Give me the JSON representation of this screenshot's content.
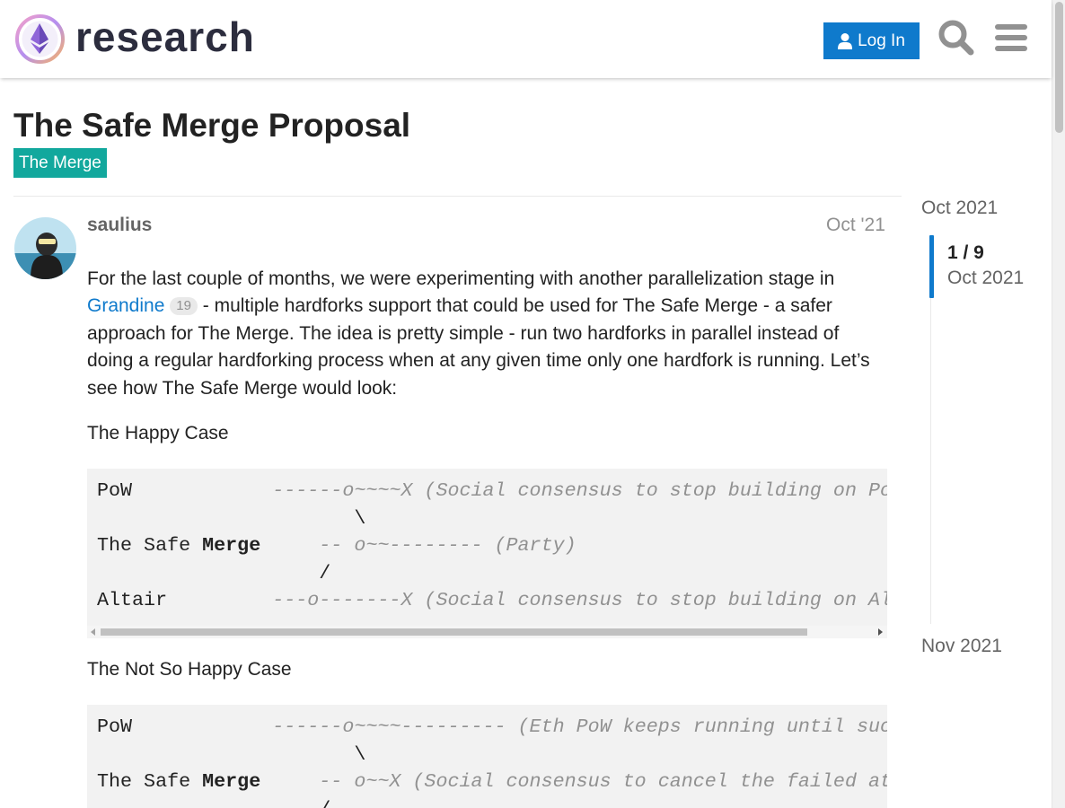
{
  "header": {
    "logo_text": "research",
    "login_label": "Log In"
  },
  "topic": {
    "title": "The Safe Merge Proposal",
    "category": "The Merge",
    "category_color": "#12a89d"
  },
  "post": {
    "username": "saulius",
    "date": "Oct '21",
    "para1_a": "For the last couple of months, we were experimenting with another parallelization stage in ",
    "link_text": "Grandine",
    "link_clicks": "19",
    "para1_b": " - multiple hardforks support that could be used for The Safe Merge - a safer approach for The Merge. The idea is pretty simple - run two hardforks in parallel instead of doing a regular hardforking process when at any given time only one hardfork is running. Let’s see how The Safe Merge would look:",
    "happy_case": "The Happy Case",
    "not_so_happy_case": "The Not So Happy Case",
    "code1": {
      "l1_label": "PoW            ",
      "l1_comment": "------o~~~~X (Social consensus to stop building on PoW)",
      "l2": "                      \\",
      "l3_label": "The Safe ",
      "l3_bold": "Merge",
      "l3_comment": "     -- o~~-------- (Party)",
      "l4": "                   /",
      "l5_label": "Altair         ",
      "l5_comment": "---o-------X (Social consensus to stop building on Altair)"
    },
    "code2": {
      "l1_label": "PoW            ",
      "l1_comment": "------o~~~~--------- (Eth PoW keeps running until successful Merge)",
      "l2": "                      \\",
      "l3_label": "The Safe ",
      "l3_bold": "Merge",
      "l3_comment": "     -- o~~X (Social consensus to cancel the failed attempt)",
      "l4": "                   /"
    }
  },
  "timeline": {
    "start": "Oct 2021",
    "position": "1 / 9",
    "position_date": "Oct 2021",
    "end": "Nov 2021",
    "accent": "#0f7acc"
  }
}
